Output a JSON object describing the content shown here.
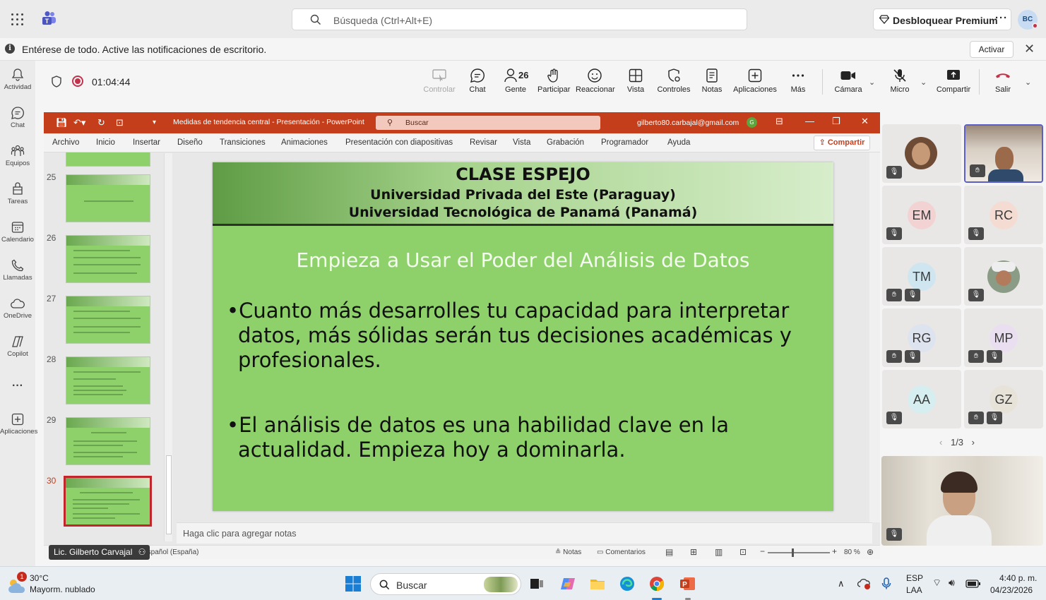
{
  "titlebar": {
    "search_placeholder": "Búsqueda (Ctrl+Alt+E)",
    "premium_label": "Desbloquear Premium",
    "more_label": "···",
    "avatar_initials": "BC"
  },
  "notification": {
    "message": "Entérese de todo. Active las notificaciones de escritorio.",
    "activate_label": "Activar"
  },
  "rail": {
    "items": [
      {
        "label": "Actividad",
        "icon": "bell-icon"
      },
      {
        "label": "Chat",
        "icon": "chat-icon"
      },
      {
        "label": "Equipos",
        "icon": "teams-icon"
      },
      {
        "label": "Tareas",
        "icon": "tasks-icon"
      },
      {
        "label": "Calendario",
        "icon": "calendar-icon"
      },
      {
        "label": "Llamadas",
        "icon": "phone-icon"
      },
      {
        "label": "OneDrive",
        "icon": "cloud-icon"
      },
      {
        "label": "Copilot",
        "icon": "copilot-icon"
      },
      {
        "label": "Aplicaciones",
        "icon": "plus-square-icon"
      }
    ],
    "more_label": "···"
  },
  "meeting": {
    "timer": "01:04:44",
    "tools": {
      "control": "Controlar",
      "chat": "Chat",
      "people": "Gente",
      "people_count": "26",
      "raise": "Participar",
      "react": "Reaccionar",
      "view": "Vista",
      "controls": "Controles",
      "notes": "Notas",
      "apps": "Aplicaciones",
      "more": "Más",
      "camera": "Cámara",
      "mic": "Micro",
      "share": "Compartir",
      "leave": "Salir"
    },
    "colors": {
      "leave": "#c4314b",
      "accent": "#5b5fc7"
    }
  },
  "powerpoint": {
    "doc_title": "Medidas de tendencia central  -  Presentación  -  PowerPoint",
    "search_placeholder": "Buscar",
    "account_email": "gilberto80.carbajal@gmail.com",
    "account_initial": "G",
    "ribbon_tabs": [
      "Archivo",
      "Inicio",
      "Insertar",
      "Diseño",
      "Transiciones",
      "Animaciones",
      "Presentación con diapositivas",
      "Revisar",
      "Vista",
      "Grabación",
      "Programador",
      "Ayuda"
    ],
    "share_label": "Compartir",
    "thumbnail_numbers": [
      "25",
      "26",
      "27",
      "28",
      "29",
      "30"
    ],
    "selected_slide": "30",
    "slide": {
      "header_line1": "CLASE ESPEJO",
      "header_line2": "Universidad Privada del Este (Paraguay)",
      "header_line3": "Universidad Tecnológica de Panamá (Panamá)",
      "title": "Empieza a Usar el Poder del Análisis de Datos",
      "bullets": [
        "Cuanto más desarrolles tu capacidad para interpretar datos, más sólidas serán tus decisiones académicas y profesionales.",
        "El análisis de datos es una habilidad clave en la actualidad. Empieza hoy a dominarla."
      ]
    },
    "notes_placeholder": "Haga clic para agregar notas",
    "status": {
      "language": "Español (España)",
      "notes": "Notas",
      "comments": "Comentarios",
      "zoom": "80 %",
      "zoom_level_pct": 80
    },
    "colors": {
      "brand": "#c43e1c",
      "slide_bg": "#8ed16a"
    }
  },
  "presenter_name": "Lic. Gilberto Carvajal",
  "participants": {
    "tiles": [
      {
        "initials": "",
        "kind": "photo"
      },
      {
        "initials": "",
        "kind": "video"
      },
      {
        "initials": "EM",
        "kind": "initials"
      },
      {
        "initials": "RC",
        "kind": "initials"
      },
      {
        "initials": "TM",
        "kind": "initials"
      },
      {
        "initials": "",
        "kind": "photo"
      },
      {
        "initials": "RG",
        "kind": "initials"
      },
      {
        "initials": "MP",
        "kind": "initials"
      },
      {
        "initials": "AA",
        "kind": "initials"
      },
      {
        "initials": "GZ",
        "kind": "initials"
      }
    ],
    "pager": "1/3"
  },
  "taskbar": {
    "weather_temp": "30°C",
    "weather_desc": "Mayorm. nublado",
    "weather_badge": "1",
    "search_label": "Buscar",
    "language_line1": "ESP",
    "language_line2": "LAA",
    "time": "4:40 p. m.",
    "date": "04/23/2026"
  }
}
